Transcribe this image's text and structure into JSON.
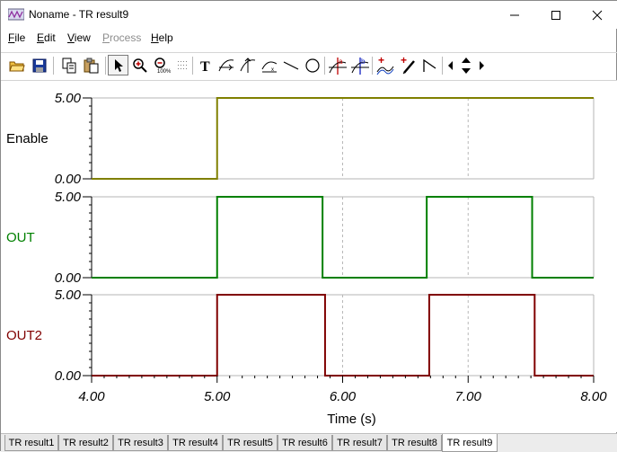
{
  "window": {
    "title": "Noname - TR result9"
  },
  "menu": {
    "items": [
      {
        "label": "File",
        "underline": "F",
        "enabled": true
      },
      {
        "label": "Edit",
        "underline": "E",
        "enabled": true
      },
      {
        "label": "View",
        "underline": "V",
        "enabled": true
      },
      {
        "label": "Process",
        "underline": "P",
        "enabled": false
      },
      {
        "label": "Help",
        "underline": "H",
        "enabled": true
      }
    ]
  },
  "toolbar": {
    "buttons": [
      {
        "name": "open-folder-icon",
        "pressed": false
      },
      {
        "name": "save-icon",
        "pressed": false
      },
      {
        "name": "copy-icon",
        "pressed": false
      },
      {
        "name": "paste-icon",
        "pressed": false
      },
      {
        "name": "select-arrow-icon",
        "pressed": true
      },
      {
        "name": "zoom-in-icon",
        "pressed": false
      },
      {
        "name": "zoom-100-icon",
        "pressed": false
      },
      {
        "name": "grid-icon",
        "pressed": false
      },
      {
        "name": "text-tool-icon",
        "pressed": false
      },
      {
        "name": "cursor-x-icon",
        "pressed": false
      },
      {
        "name": "cursor-y-icon",
        "pressed": false
      },
      {
        "name": "curve-icon",
        "pressed": false
      },
      {
        "name": "line-tool-icon",
        "pressed": false
      },
      {
        "name": "ellipse-tool-icon",
        "pressed": false
      },
      {
        "name": "cursor-a-icon",
        "pressed": false
      },
      {
        "name": "cursor-b-icon",
        "pressed": false
      },
      {
        "name": "add-curve-icon",
        "pressed": false
      },
      {
        "name": "pen-icon",
        "pressed": false
      },
      {
        "name": "slope-icon",
        "pressed": false
      },
      {
        "name": "nav-left-icon",
        "pressed": false
      },
      {
        "name": "nav-updown-icon",
        "pressed": false
      },
      {
        "name": "nav-right-icon",
        "pressed": false
      }
    ]
  },
  "chart_data": {
    "type": "line",
    "xlabel": "Time (s)",
    "xlim": [
      4.0,
      8.0
    ],
    "x_ticks": [
      "4.00",
      "5.00",
      "6.00",
      "7.00",
      "8.00"
    ],
    "grid": "dashed vertical at 6.00 and 7.00",
    "series": [
      {
        "name": "Enable",
        "color": "#808000",
        "ylim": [
          0.0,
          5.0
        ],
        "y_ticks": [
          "0.00",
          "5.00"
        ],
        "x": [
          4.0,
          5.0,
          5.0,
          8.0
        ],
        "y": [
          0.0,
          0.0,
          5.0,
          5.0
        ]
      },
      {
        "name": "OUT",
        "color": "#008000",
        "ylim": [
          0.0,
          5.0
        ],
        "y_ticks": [
          "0.00",
          "5.00"
        ],
        "x": [
          4.0,
          5.0,
          5.0,
          5.84,
          5.84,
          6.67,
          6.67,
          7.51,
          7.51,
          8.0
        ],
        "y": [
          0.0,
          0.0,
          5.0,
          5.0,
          0.0,
          0.0,
          5.0,
          5.0,
          0.0,
          0.0
        ]
      },
      {
        "name": "OUT2",
        "color": "#800000",
        "ylim": [
          0.0,
          5.0
        ],
        "y_ticks": [
          "0.00",
          "5.00"
        ],
        "x": [
          4.0,
          5.0,
          5.0,
          5.86,
          5.86,
          6.69,
          6.69,
          7.53,
          7.53,
          8.0
        ],
        "y": [
          0.0,
          0.0,
          5.0,
          5.0,
          0.0,
          0.0,
          5.0,
          5.0,
          0.0,
          0.0
        ]
      }
    ]
  },
  "tabs": {
    "items": [
      "TR result1",
      "TR result2",
      "TR result3",
      "TR result4",
      "TR result5",
      "TR result6",
      "TR result7",
      "TR result8",
      "TR result9"
    ],
    "active_index": 8
  }
}
